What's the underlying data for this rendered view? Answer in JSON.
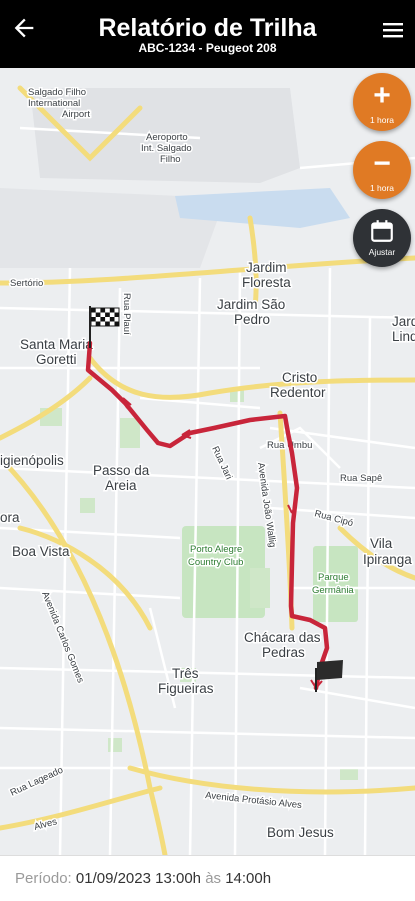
{
  "header": {
    "title": "Relatório de Trilha",
    "subtitle": "ABC-1234 - Peugeot 208"
  },
  "controls": {
    "zoom_in": {
      "symbol": "+",
      "caption": "1 hora"
    },
    "zoom_out": {
      "symbol": "−",
      "caption": "1 hora"
    },
    "adjust": {
      "caption": "Ajustar"
    }
  },
  "map": {
    "labels": {
      "airport_salgado": "Salgado Filho",
      "airport_intl": "International",
      "airport": "Airport",
      "aero1": "Aeroporto",
      "aero2": "Int. Salgado",
      "aero3": "Filho",
      "sertorio": "Sertório",
      "jardim_floresta_1": "Jardim",
      "jardim_floresta_2": "Floresta",
      "jardim_sao_pedro_1": "Jardim São",
      "jardim_sao_pedro_2": "Pedro",
      "jardim_lindoia_1": "Jard",
      "jardim_lindoia_2": "Lind",
      "santa_maria_1": "Santa Maria",
      "santa_maria_2": "Goretti",
      "rua_plaui": "Rua Plauí",
      "cristo_1": "Cristo",
      "cristo_2": "Redentor",
      "higienopolis": "igienópolis",
      "passo_areia_1": "Passo da",
      "passo_areia_2": "Areia",
      "rua_itaboraí": "Rua Umbu",
      "rua_jari": "Rua Jari",
      "rua_sape": "Rua Sapê",
      "rua_cipo": "Rua Cipó",
      "avenida_wallig": "Avenida João Wallig",
      "vila_ipiranga_1": "Vila",
      "vila_ipiranga_2": "Ipiranga",
      "flora": "ora",
      "boa_vista": "Boa Vista",
      "country_1": "Porto Alegre",
      "country_2": "Country Club",
      "parque_1": "Parque",
      "parque_2": "Germânia",
      "av_carlos_gomes": "Avenida Carlos Gomes",
      "chacara_1": "Chácara das",
      "chacara_2": "Pedras",
      "tres_1": "Três",
      "tres_2": "Figueiras",
      "rua_lageado": "Rua Lageado",
      "av_protasio": "Avenida Protásio Alves",
      "bom_jesus": "Bom Jesus",
      "rua_alves": "Alves"
    }
  },
  "footer": {
    "period_label": "Período:",
    "date_start": "01/09/2023 13:00",
    "h1": "h",
    "between": "às",
    "end": "14:00h"
  },
  "colors": {
    "accent": "#e07a24",
    "dark_button": "#2f3236",
    "route": "#c8253a",
    "header_bg": "#000000"
  }
}
